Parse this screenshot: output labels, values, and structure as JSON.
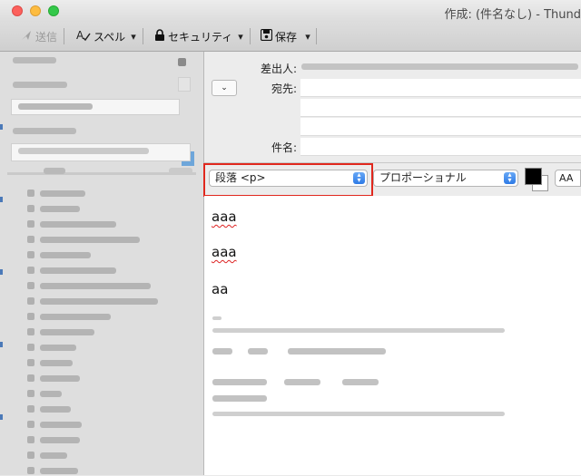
{
  "window": {
    "title": "作成: (件名なし) - Thund"
  },
  "toolbar": {
    "send_label": "送信",
    "spell_label": "スペル",
    "security_label": "セキュリティ",
    "save_label": "保存",
    "dropdown_glyph": "▾"
  },
  "headers": {
    "from_label": "差出人:",
    "to_label": "宛先:",
    "subject_label": "件名:",
    "expand_glyph": "⌄"
  },
  "formatbar": {
    "paragraph_format": "段落 <p>",
    "font": "プロポーショナル",
    "font_size_label": "AA",
    "stepper_glyph": "⇕",
    "text_color": "#000000"
  },
  "body": {
    "paragraphs": [
      "aaa",
      "aaa",
      "aa"
    ]
  },
  "colors": {
    "highlight_border": "#e0281e",
    "select_accent": "#2d7ae6"
  },
  "icons": {
    "send": "send-icon",
    "spell": "spellcheck-icon",
    "security": "lock-icon",
    "save": "save-icon"
  }
}
